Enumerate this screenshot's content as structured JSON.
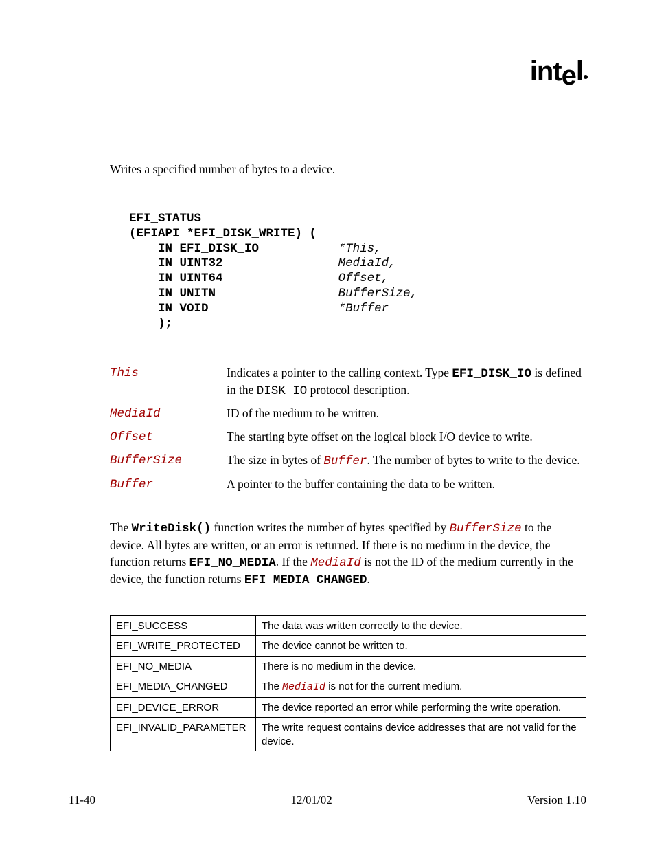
{
  "logo": "intel",
  "summary": "Writes a specified number of bytes to a device.",
  "proto": {
    "l1a": "EFI_STATUS",
    "l2a": "(EFIAPI *EFI_DISK_WRITE) (",
    "r1k": "IN EFI_DISK_IO",
    "r1p": "*This,",
    "r2k": "IN UINT32",
    "r2p": "MediaId,",
    "r3k": "IN UINT64",
    "r3p": "Offset,",
    "r4k": "IN UNITN",
    "r4p": "BufferSize,",
    "r5k": "IN VOID",
    "r5p": "*Buffer",
    "r6k": ");"
  },
  "params": [
    {
      "name": "This",
      "desc_pre": "Indicates a pointer to the calling context.  Type ",
      "mono1": "EFI_DISK_IO",
      "desc_mid": " is defined in the ",
      "link1": "DISK_IO",
      "desc_post": " protocol description."
    },
    {
      "name": "MediaId",
      "desc": "ID of the medium to be written."
    },
    {
      "name": "Offset",
      "desc": "The starting byte offset on the logical block I/O device to write."
    },
    {
      "name": "BufferSize",
      "desc_pre": "The size in bytes of ",
      "ital1": "Buffer",
      "desc_post": ".  The number of bytes to write to the device."
    },
    {
      "name": "Buffer",
      "desc": "A pointer to the buffer containing the data to be written."
    }
  ],
  "description": {
    "t1": "The ",
    "fn": "WriteDisk()",
    "t2": " function writes the number of bytes specified by ",
    "p1": "BufferSize",
    "t3": " to the device.  All bytes are written, or an error is returned.  If there is no medium in the device, the function returns ",
    "c1": "EFI_NO_MEDIA",
    "t4": ".  If the ",
    "p2": "MediaId",
    "t5": " is not the ID of the medium currently in the device, the function returns ",
    "c2": "EFI_MEDIA_CHANGED",
    "t6": "."
  },
  "status": [
    {
      "code": "EFI_SUCCESS",
      "desc": "The data was written correctly to the device."
    },
    {
      "code": "EFI_WRITE_PROTECTED",
      "desc": "The device cannot be written to."
    },
    {
      "code": "EFI_NO_MEDIA",
      "desc": "There is no medium in the device."
    },
    {
      "code": "EFI_MEDIA_CHANGED",
      "desc_pre": "The ",
      "ital": "MediaId",
      "desc_post": " is not for the current medium."
    },
    {
      "code": "EFI_DEVICE_ERROR",
      "desc": "The device reported an error while performing the write operation."
    },
    {
      "code": "EFI_INVALID_PARAMETER",
      "desc": "The write request contains device addresses that are not valid for the device."
    }
  ],
  "footer": {
    "left": "11-40",
    "center": "12/01/02",
    "right": "Version 1.10"
  }
}
